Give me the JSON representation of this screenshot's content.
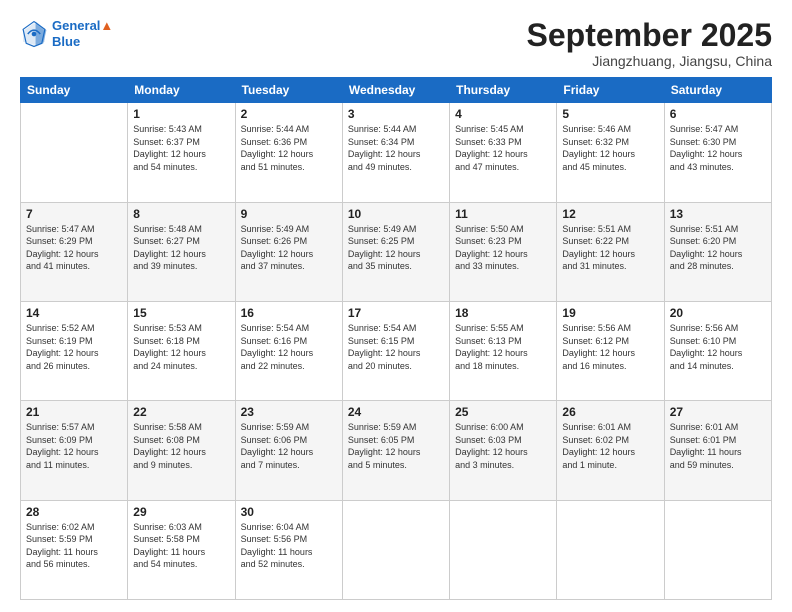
{
  "header": {
    "logo_line1": "General",
    "logo_line2": "Blue",
    "month": "September 2025",
    "location": "Jiangzhuang, Jiangsu, China"
  },
  "days_of_week": [
    "Sunday",
    "Monday",
    "Tuesday",
    "Wednesday",
    "Thursday",
    "Friday",
    "Saturday"
  ],
  "weeks": [
    [
      {
        "day": "",
        "info": ""
      },
      {
        "day": "1",
        "info": "Sunrise: 5:43 AM\nSunset: 6:37 PM\nDaylight: 12 hours\nand 54 minutes."
      },
      {
        "day": "2",
        "info": "Sunrise: 5:44 AM\nSunset: 6:36 PM\nDaylight: 12 hours\nand 51 minutes."
      },
      {
        "day": "3",
        "info": "Sunrise: 5:44 AM\nSunset: 6:34 PM\nDaylight: 12 hours\nand 49 minutes."
      },
      {
        "day": "4",
        "info": "Sunrise: 5:45 AM\nSunset: 6:33 PM\nDaylight: 12 hours\nand 47 minutes."
      },
      {
        "day": "5",
        "info": "Sunrise: 5:46 AM\nSunset: 6:32 PM\nDaylight: 12 hours\nand 45 minutes."
      },
      {
        "day": "6",
        "info": "Sunrise: 5:47 AM\nSunset: 6:30 PM\nDaylight: 12 hours\nand 43 minutes."
      }
    ],
    [
      {
        "day": "7",
        "info": "Sunrise: 5:47 AM\nSunset: 6:29 PM\nDaylight: 12 hours\nand 41 minutes."
      },
      {
        "day": "8",
        "info": "Sunrise: 5:48 AM\nSunset: 6:27 PM\nDaylight: 12 hours\nand 39 minutes."
      },
      {
        "day": "9",
        "info": "Sunrise: 5:49 AM\nSunset: 6:26 PM\nDaylight: 12 hours\nand 37 minutes."
      },
      {
        "day": "10",
        "info": "Sunrise: 5:49 AM\nSunset: 6:25 PM\nDaylight: 12 hours\nand 35 minutes."
      },
      {
        "day": "11",
        "info": "Sunrise: 5:50 AM\nSunset: 6:23 PM\nDaylight: 12 hours\nand 33 minutes."
      },
      {
        "day": "12",
        "info": "Sunrise: 5:51 AM\nSunset: 6:22 PM\nDaylight: 12 hours\nand 31 minutes."
      },
      {
        "day": "13",
        "info": "Sunrise: 5:51 AM\nSunset: 6:20 PM\nDaylight: 12 hours\nand 28 minutes."
      }
    ],
    [
      {
        "day": "14",
        "info": "Sunrise: 5:52 AM\nSunset: 6:19 PM\nDaylight: 12 hours\nand 26 minutes."
      },
      {
        "day": "15",
        "info": "Sunrise: 5:53 AM\nSunset: 6:18 PM\nDaylight: 12 hours\nand 24 minutes."
      },
      {
        "day": "16",
        "info": "Sunrise: 5:54 AM\nSunset: 6:16 PM\nDaylight: 12 hours\nand 22 minutes."
      },
      {
        "day": "17",
        "info": "Sunrise: 5:54 AM\nSunset: 6:15 PM\nDaylight: 12 hours\nand 20 minutes."
      },
      {
        "day": "18",
        "info": "Sunrise: 5:55 AM\nSunset: 6:13 PM\nDaylight: 12 hours\nand 18 minutes."
      },
      {
        "day": "19",
        "info": "Sunrise: 5:56 AM\nSunset: 6:12 PM\nDaylight: 12 hours\nand 16 minutes."
      },
      {
        "day": "20",
        "info": "Sunrise: 5:56 AM\nSunset: 6:10 PM\nDaylight: 12 hours\nand 14 minutes."
      }
    ],
    [
      {
        "day": "21",
        "info": "Sunrise: 5:57 AM\nSunset: 6:09 PM\nDaylight: 12 hours\nand 11 minutes."
      },
      {
        "day": "22",
        "info": "Sunrise: 5:58 AM\nSunset: 6:08 PM\nDaylight: 12 hours\nand 9 minutes."
      },
      {
        "day": "23",
        "info": "Sunrise: 5:59 AM\nSunset: 6:06 PM\nDaylight: 12 hours\nand 7 minutes."
      },
      {
        "day": "24",
        "info": "Sunrise: 5:59 AM\nSunset: 6:05 PM\nDaylight: 12 hours\nand 5 minutes."
      },
      {
        "day": "25",
        "info": "Sunrise: 6:00 AM\nSunset: 6:03 PM\nDaylight: 12 hours\nand 3 minutes."
      },
      {
        "day": "26",
        "info": "Sunrise: 6:01 AM\nSunset: 6:02 PM\nDaylight: 12 hours\nand 1 minute."
      },
      {
        "day": "27",
        "info": "Sunrise: 6:01 AM\nSunset: 6:01 PM\nDaylight: 11 hours\nand 59 minutes."
      }
    ],
    [
      {
        "day": "28",
        "info": "Sunrise: 6:02 AM\nSunset: 5:59 PM\nDaylight: 11 hours\nand 56 minutes."
      },
      {
        "day": "29",
        "info": "Sunrise: 6:03 AM\nSunset: 5:58 PM\nDaylight: 11 hours\nand 54 minutes."
      },
      {
        "day": "30",
        "info": "Sunrise: 6:04 AM\nSunset: 5:56 PM\nDaylight: 11 hours\nand 52 minutes."
      },
      {
        "day": "",
        "info": ""
      },
      {
        "day": "",
        "info": ""
      },
      {
        "day": "",
        "info": ""
      },
      {
        "day": "",
        "info": ""
      }
    ]
  ]
}
